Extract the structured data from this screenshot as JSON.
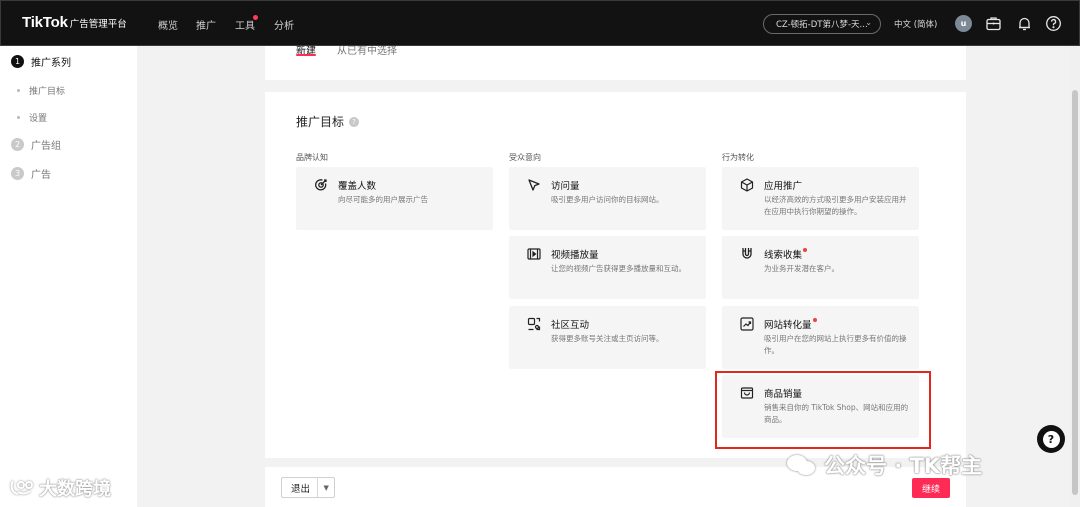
{
  "header": {
    "logo": "TikTok",
    "logo_sub": "广告管理平台",
    "nav": [
      "概览",
      "推广",
      "工具",
      "分析"
    ],
    "account": "CZ-顿拓-DT第八梦-天...",
    "language": "中文 (简体)",
    "avatar_initial": "u"
  },
  "sidebar": {
    "steps": [
      {
        "num": "1",
        "label": "推广系列"
      },
      {
        "num": "2",
        "label": "广告组"
      },
      {
        "num": "3",
        "label": "广告"
      }
    ],
    "substeps": [
      "推广目标",
      "设置"
    ]
  },
  "tabs": {
    "new": "新建",
    "existing": "从已有中选择"
  },
  "objective": {
    "title": "推广目标",
    "help": "?",
    "columns": [
      "品牌认知",
      "受众意向",
      "行为转化"
    ],
    "options": [
      {
        "title": "覆盖人数",
        "desc": "向尽可能多的用户展示广告"
      },
      {
        "title": "访问量",
        "desc": "吸引更多用户访问你的目标网站。"
      },
      {
        "title": "视频播放量",
        "desc": "让您的视频广告获得更多播放量和互动。"
      },
      {
        "title": "社区互动",
        "desc": "获得更多账号关注或主页访问等。"
      },
      {
        "title": "应用推广",
        "desc": "以经济高效的方式吸引更多用户安装应用并在应用中执行你期望的操作。"
      },
      {
        "title": "线索收集",
        "desc": "为业务开发潜在客户。"
      },
      {
        "title": "网站转化量",
        "desc": "吸引用户在您的网站上执行更多有价值的操作。"
      },
      {
        "title": "商品销量",
        "desc": "销售来自你的 TikTok Shop、网站和应用的商品。"
      }
    ]
  },
  "footer": {
    "exit": "退出",
    "continue": "继续"
  },
  "fab": "?",
  "watermarks": {
    "left": "大数跨境",
    "right": "公众号 · TK帮主"
  },
  "colors": {
    "accent": "#fe2c55",
    "highlight": "#e0281e",
    "topbar": "#121212"
  }
}
